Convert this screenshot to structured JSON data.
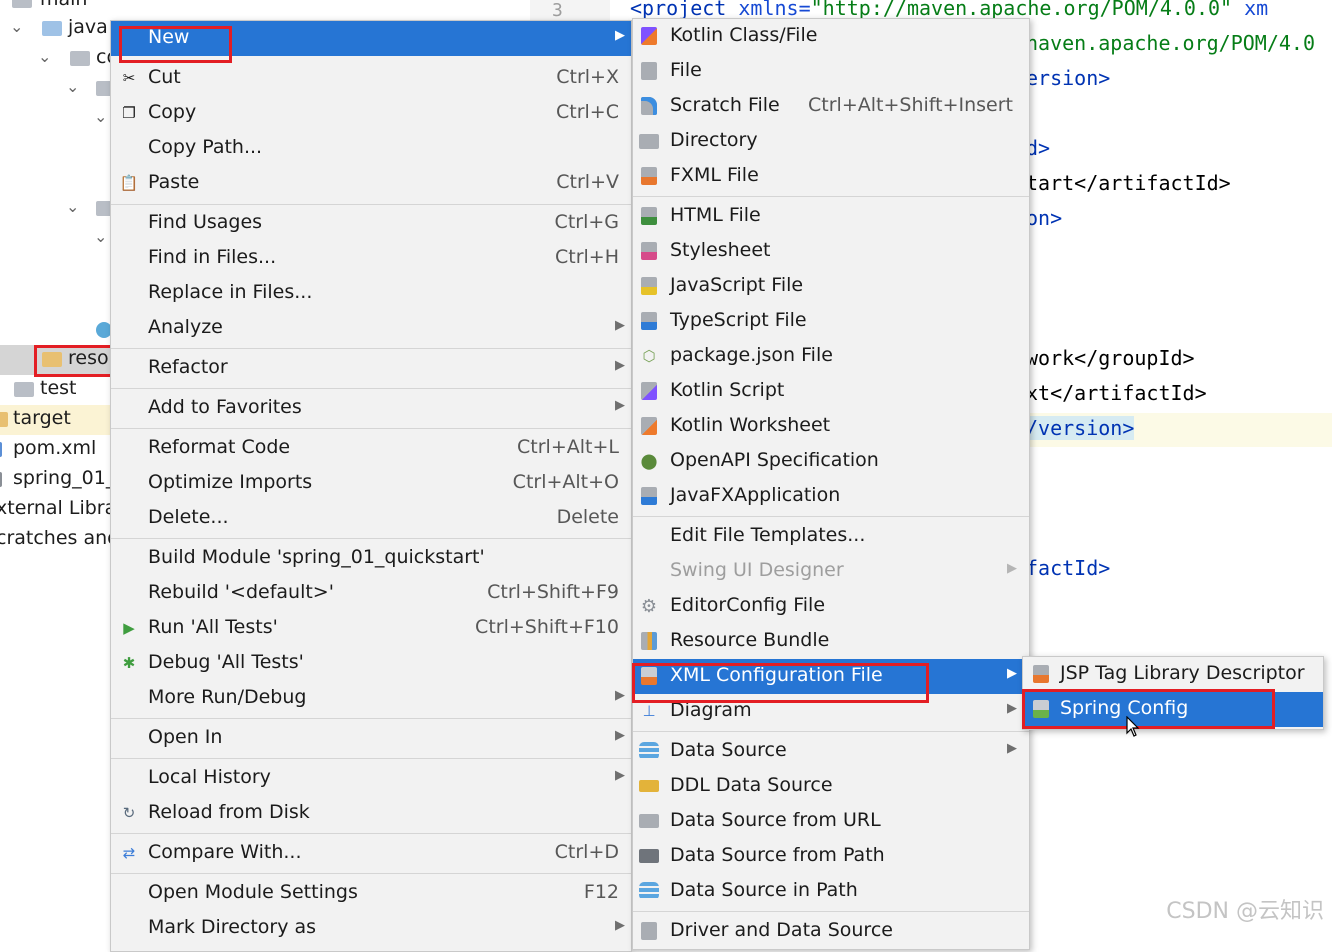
{
  "tree": {
    "items": [
      {
        "label": "main",
        "kind": "folder"
      },
      {
        "label": "java",
        "kind": "folder"
      },
      {
        "label": "co",
        "kind": "package"
      },
      {
        "label": "",
        "kind": "package"
      },
      {
        "label": "",
        "kind": "package"
      },
      {
        "label": "",
        "kind": "package"
      },
      {
        "label": "",
        "kind": "package"
      },
      {
        "label": "reso",
        "kind": "resources"
      },
      {
        "label": "test",
        "kind": "folder"
      },
      {
        "label": "target",
        "kind": "folder"
      },
      {
        "label": "pom.xml",
        "kind": "file"
      },
      {
        "label": "spring_01_",
        "kind": "file"
      },
      {
        "label": "xternal Libra",
        "kind": "lib"
      },
      {
        "label": "cratches and",
        "kind": "scratch"
      }
    ]
  },
  "editor": {
    "line_number": "3",
    "lines": [
      {
        "t1": "<project ",
        "t2": "xmlns=",
        "t3": "\"http://maven.apache.org/POM/4.0.0\"",
        "t4": " xm"
      },
      {
        "text": "naven.apache.org/POM/4.0"
      },
      {
        "text": "ersion>"
      },
      {
        "text": "d>"
      },
      {
        "text": "tart</artifactId>"
      },
      {
        "text": "on>"
      },
      {
        "text": "work</groupId>"
      },
      {
        "text": "xt</artifactId>"
      },
      {
        "text": "/version>"
      },
      {
        "text": "factId>"
      }
    ]
  },
  "context_menu": {
    "items": [
      {
        "label": "New",
        "shortcut": "",
        "submenu": true,
        "icon": "none-icon",
        "selected": true
      },
      {
        "label": "Cut",
        "shortcut": "Ctrl+X",
        "icon": "scissors-icon"
      },
      {
        "label": "Copy",
        "shortcut": "Ctrl+C",
        "icon": "copy-icon"
      },
      {
        "label": "Copy Path...",
        "shortcut": "",
        "icon": ""
      },
      {
        "label": "Paste",
        "shortcut": "Ctrl+V",
        "icon": "clipboard-icon"
      },
      {
        "label": "Find Usages",
        "shortcut": "Ctrl+G",
        "icon": ""
      },
      {
        "label": "Find in Files...",
        "shortcut": "Ctrl+H",
        "icon": ""
      },
      {
        "label": "Replace in Files...",
        "shortcut": "",
        "icon": ""
      },
      {
        "label": "Analyze",
        "shortcut": "",
        "submenu": true,
        "icon": ""
      },
      {
        "label": "Refactor",
        "shortcut": "",
        "submenu": true,
        "icon": ""
      },
      {
        "label": "Add to Favorites",
        "shortcut": "",
        "submenu": true,
        "icon": ""
      },
      {
        "label": "Reformat Code",
        "shortcut": "Ctrl+Alt+L",
        "icon": ""
      },
      {
        "label": "Optimize Imports",
        "shortcut": "Ctrl+Alt+O",
        "icon": ""
      },
      {
        "label": "Delete...",
        "shortcut": "Delete",
        "icon": ""
      },
      {
        "label": "Build Module 'spring_01_quickstart'",
        "shortcut": "",
        "icon": ""
      },
      {
        "label": "Rebuild '<default>'",
        "shortcut": "Ctrl+Shift+F9",
        "icon": ""
      },
      {
        "label": "Run 'All Tests'",
        "shortcut": "Ctrl+Shift+F10",
        "icon": "run-icon"
      },
      {
        "label": "Debug 'All Tests'",
        "shortcut": "",
        "icon": "debug-icon"
      },
      {
        "label": "More Run/Debug",
        "shortcut": "",
        "submenu": true,
        "icon": ""
      },
      {
        "label": "Open In",
        "shortcut": "",
        "submenu": true,
        "icon": ""
      },
      {
        "label": "Local History",
        "shortcut": "",
        "submenu": true,
        "icon": ""
      },
      {
        "label": "Reload from Disk",
        "shortcut": "",
        "icon": "reload-icon"
      },
      {
        "label": "Compare With...",
        "shortcut": "Ctrl+D",
        "icon": "compare-icon"
      },
      {
        "label": "Open Module Settings",
        "shortcut": "F12",
        "icon": ""
      },
      {
        "label": "Mark Directory as",
        "shortcut": "",
        "submenu": true,
        "icon": ""
      }
    ]
  },
  "new_submenu": {
    "items": [
      {
        "label": "Kotlin Class/File",
        "shortcut": "",
        "icon": "kotlin-icon"
      },
      {
        "label": "File",
        "shortcut": "",
        "icon": "file-icon"
      },
      {
        "label": "Scratch File",
        "shortcut": "Ctrl+Alt+Shift+Insert",
        "icon": "scratch-file-icon"
      },
      {
        "label": "Directory",
        "shortcut": "",
        "icon": "folder-icon"
      },
      {
        "label": "FXML File",
        "shortcut": "",
        "icon": "fxml-icon"
      },
      {
        "label": "HTML File",
        "shortcut": "",
        "icon": "html-icon"
      },
      {
        "label": "Stylesheet",
        "shortcut": "",
        "icon": "css-icon"
      },
      {
        "label": "JavaScript File",
        "shortcut": "",
        "icon": "js-icon"
      },
      {
        "label": "TypeScript File",
        "shortcut": "",
        "icon": "ts-icon"
      },
      {
        "label": "package.json File",
        "shortcut": "",
        "icon": "nodejs-icon"
      },
      {
        "label": "Kotlin Script",
        "shortcut": "",
        "icon": "kotlin-script-icon"
      },
      {
        "label": "Kotlin Worksheet",
        "shortcut": "",
        "icon": "kotlin-worksheet-icon"
      },
      {
        "label": "OpenAPI Specification",
        "shortcut": "",
        "icon": "openapi-icon"
      },
      {
        "label": "JavaFXApplication",
        "shortcut": "",
        "icon": "javafx-icon"
      },
      {
        "label": "Edit File Templates...",
        "shortcut": "",
        "icon": ""
      },
      {
        "label": "Swing UI Designer",
        "shortcut": "",
        "submenu": true,
        "disabled": true,
        "icon": ""
      },
      {
        "label": "EditorConfig File",
        "shortcut": "",
        "icon": "gear-icon"
      },
      {
        "label": "Resource Bundle",
        "shortcut": "",
        "icon": "resource-bundle-icon"
      },
      {
        "label": "XML Configuration File",
        "shortcut": "",
        "submenu": true,
        "selected": true,
        "icon": "xml-icon"
      },
      {
        "label": "Diagram",
        "shortcut": "",
        "submenu": true,
        "icon": "diagram-icon"
      },
      {
        "label": "Data Source",
        "shortcut": "",
        "submenu": true,
        "icon": "database-icon"
      },
      {
        "label": "DDL Data Source",
        "shortcut": "",
        "icon": "ddl-icon"
      },
      {
        "label": "Data Source from URL",
        "shortcut": "",
        "icon": "url-icon"
      },
      {
        "label": "Data Source from Path",
        "shortcut": "",
        "icon": "folder-open-icon"
      },
      {
        "label": "Data Source in Path",
        "shortcut": "",
        "icon": "database-icon"
      },
      {
        "label": "Driver and Data Source",
        "shortcut": "",
        "icon": "driver-icon"
      }
    ]
  },
  "xml_submenu": {
    "items": [
      {
        "label": "JSP Tag Library Descriptor",
        "icon": "jsp-icon"
      },
      {
        "label": "Spring Config",
        "icon": "spring-config-icon",
        "selected": true
      }
    ]
  },
  "watermark": "CSDN @云知识",
  "colors": {
    "selection": "#2675d4",
    "highlight_box": "#e31e24",
    "menu_bg": "#f2f2f2"
  }
}
